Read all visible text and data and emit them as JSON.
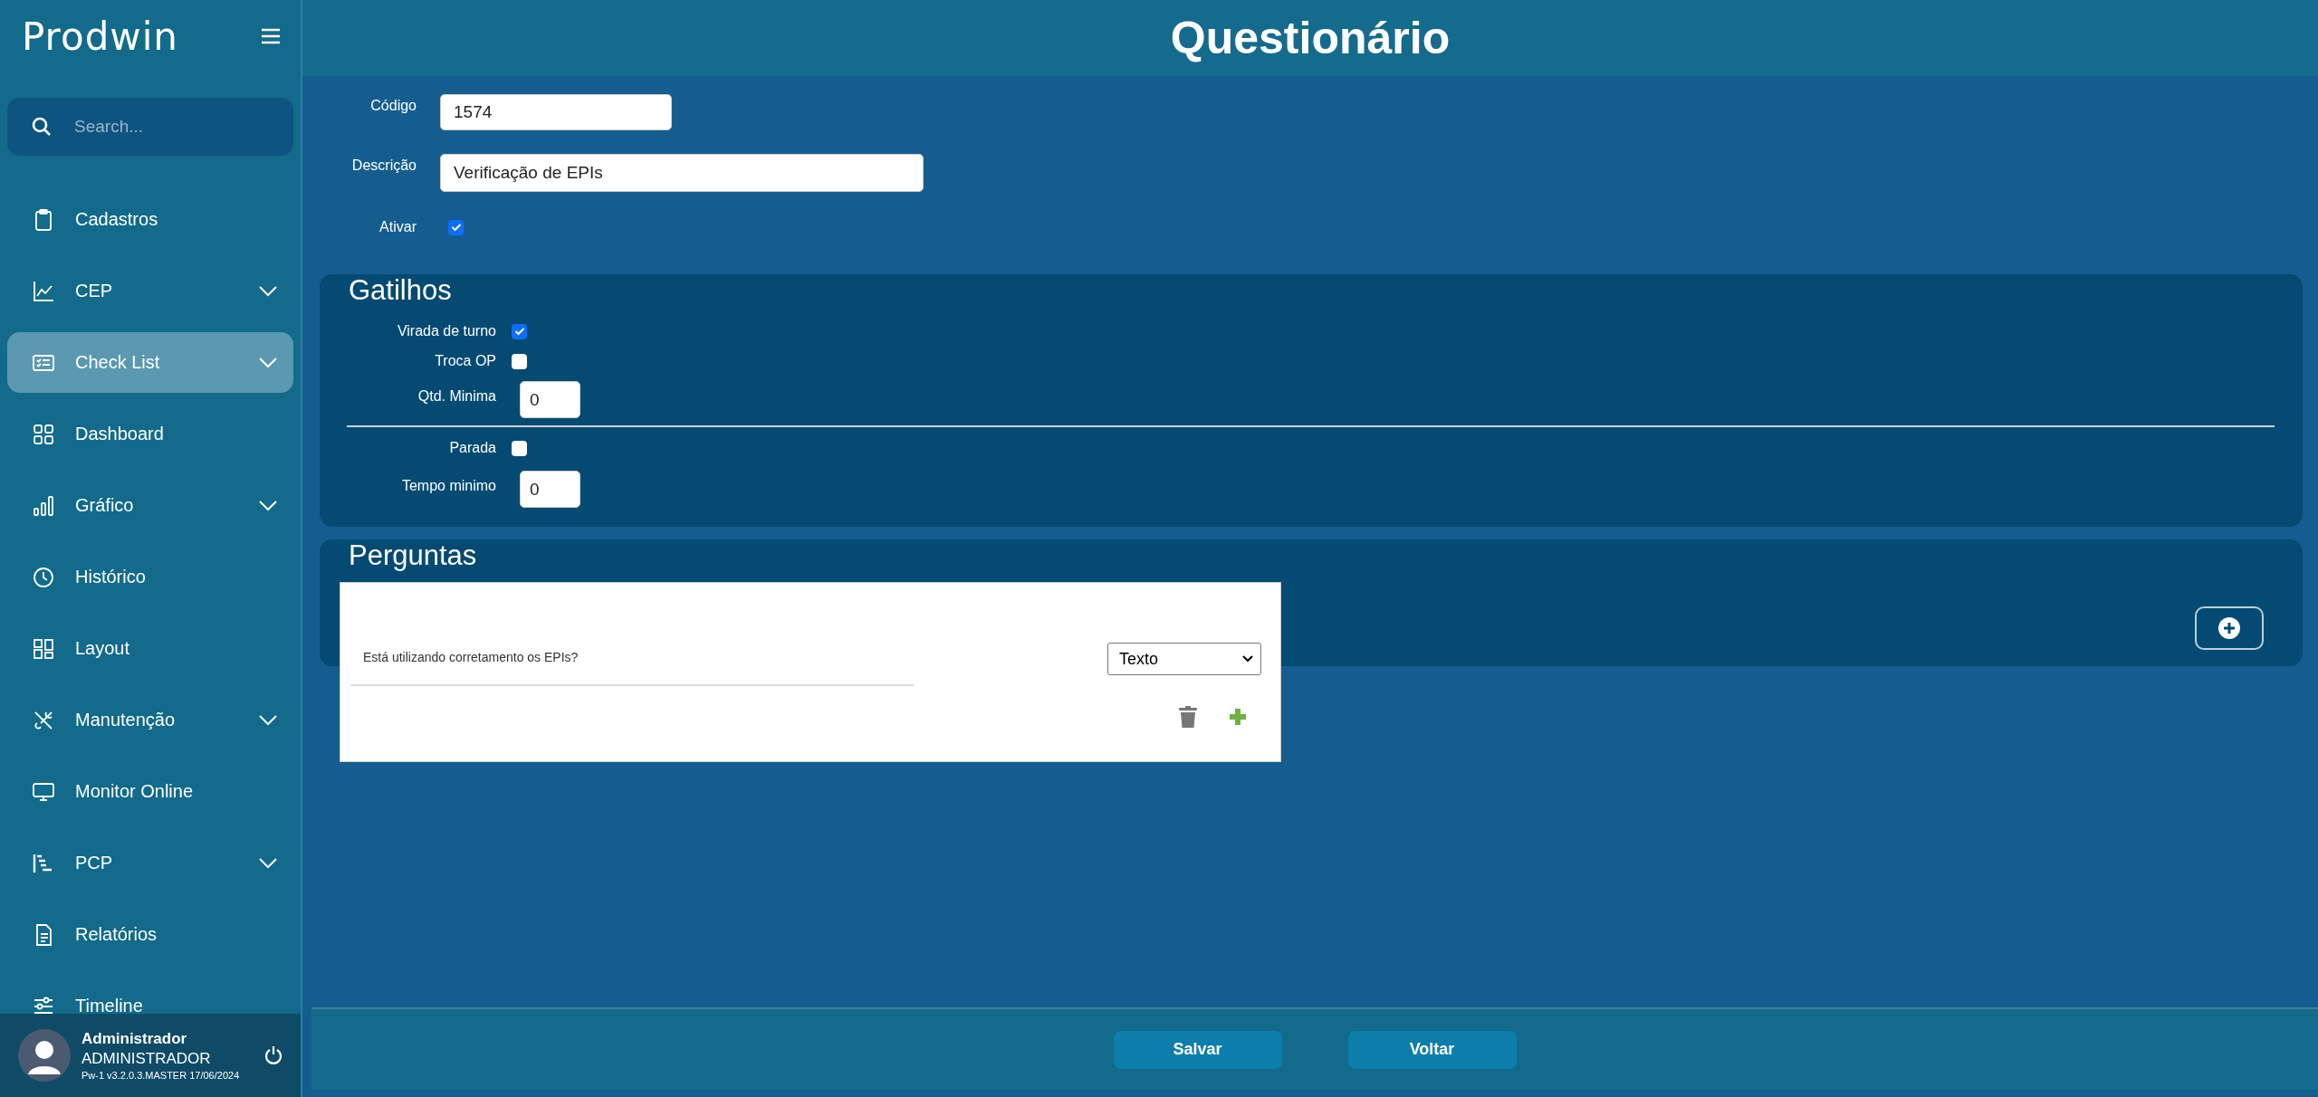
{
  "sidebar": {
    "logo": "Prodwin",
    "search": {
      "placeholder": "Search..."
    },
    "items": [
      {
        "label": "Cadastros",
        "expandable": false,
        "selected": false
      },
      {
        "label": "CEP",
        "expandable": true,
        "selected": false
      },
      {
        "label": "Check List",
        "expandable": true,
        "selected": true
      },
      {
        "label": "Dashboard",
        "expandable": false,
        "selected": false
      },
      {
        "label": "Gráfico",
        "expandable": true,
        "selected": false
      },
      {
        "label": "Histórico",
        "expandable": false,
        "selected": false
      },
      {
        "label": "Layout",
        "expandable": false,
        "selected": false
      },
      {
        "label": "Manutenção",
        "expandable": true,
        "selected": false
      },
      {
        "label": "Monitor Online",
        "expandable": false,
        "selected": false
      },
      {
        "label": "PCP",
        "expandable": true,
        "selected": false
      },
      {
        "label": "Relatórios",
        "expandable": false,
        "selected": false
      },
      {
        "label": "Timeline",
        "expandable": false,
        "selected": false
      }
    ],
    "user": {
      "name": "Administrador",
      "role": "ADMINISTRADOR",
      "version": "Pw-1 v3.2.0.3.MASTER 17/06/2024"
    }
  },
  "header": {
    "title": "Questionário"
  },
  "form": {
    "codigo": {
      "label": "Código",
      "value": "1574"
    },
    "descricao": {
      "label": "Descrição",
      "value": "Verificação de EPIs"
    },
    "ativar": {
      "label": "Ativar",
      "checked": true
    }
  },
  "gatilhos": {
    "title": "Gatilhos",
    "groups": [
      [
        {
          "kind": "checkbox",
          "label": "Virada de turno",
          "checked": true
        },
        {
          "kind": "checkbox",
          "label": "Troca OP",
          "checked": false
        },
        {
          "kind": "number",
          "label": "Qtd. Minima",
          "value": "0"
        }
      ],
      [
        {
          "kind": "checkbox",
          "label": "Parada",
          "checked": false
        },
        {
          "kind": "number",
          "label": "Tempo minimo",
          "value": "0"
        }
      ]
    ]
  },
  "perguntas": {
    "title": "Perguntas",
    "questions": [
      {
        "text": "Está utilizando corretamento os EPIs?",
        "type": "Texto"
      }
    ]
  },
  "footer": {
    "buttons": [
      "Salvar",
      "Voltar"
    ]
  }
}
